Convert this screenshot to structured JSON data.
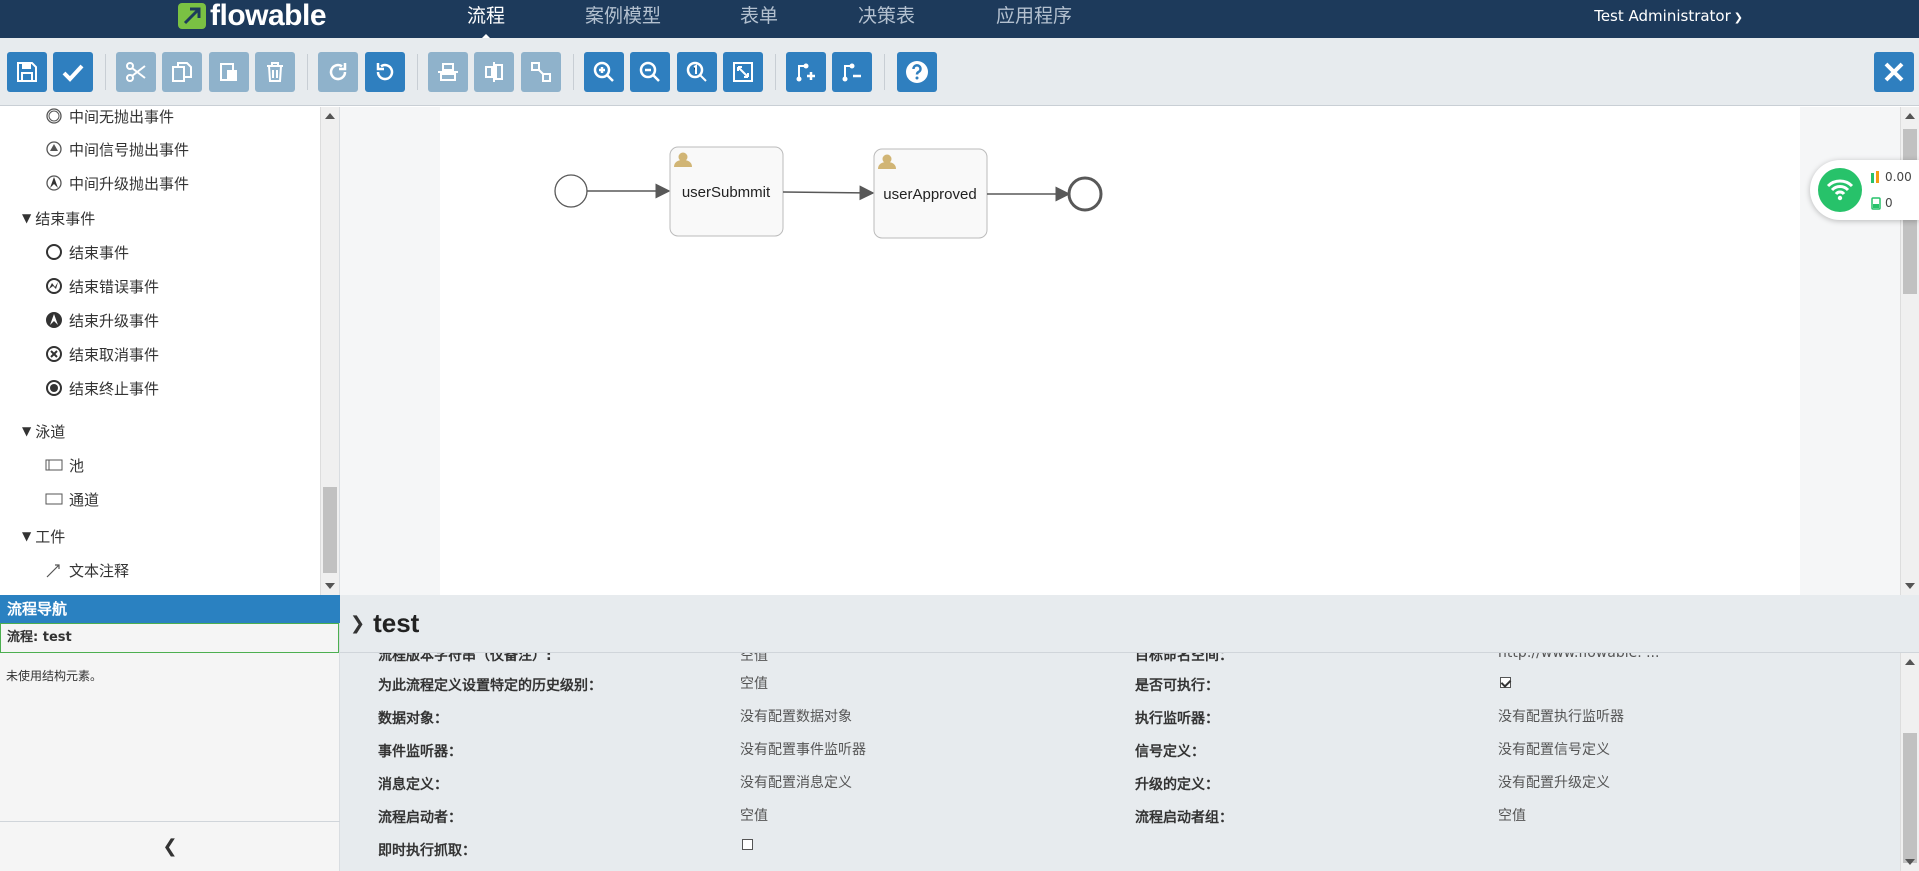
{
  "app": {
    "logo_text": "flowable"
  },
  "nav": {
    "tabs": [
      "流程",
      "案例模型",
      "表单",
      "决策表",
      "应用程序"
    ],
    "active_tab": "流程",
    "user": "Test Administrator"
  },
  "toolbar": {
    "buttons": [
      "save-icon",
      "validate-icon",
      "cut-icon",
      "copy-icon",
      "paste-icon",
      "delete-icon",
      "redo-icon",
      "undo-icon",
      "align-horizontal-icon",
      "align-vertical-icon",
      "same-size-icon",
      "zoom-in-icon",
      "zoom-out-icon",
      "zoom-actual-icon",
      "zoom-fit-icon",
      "add-bendpoint-icon",
      "remove-bendpoint-icon",
      "help-icon",
      "close-icon"
    ]
  },
  "palette": {
    "items_top": [
      "中间无抛出事件",
      "中间信号抛出事件",
      "中间升级抛出事件"
    ],
    "groups": [
      {
        "label": "结束事件",
        "items": [
          "结束事件",
          "结束错误事件",
          "结束升级事件",
          "结束取消事件",
          "结束终止事件"
        ]
      },
      {
        "label": "泳道",
        "items": [
          "池",
          "通道"
        ]
      },
      {
        "label": "工件",
        "items": [
          "文本注释"
        ]
      }
    ]
  },
  "diagram": {
    "tasks": [
      "userSubmmit",
      "userApproved"
    ]
  },
  "net_widget": {
    "speed": "0.00",
    "count": "0"
  },
  "navigator": {
    "title": "流程导航",
    "process": "流程: test",
    "note": "未使用结构元素。"
  },
  "properties": {
    "title": "test",
    "rows": [
      {
        "l_label": "流程版本字符串（仅备注）:",
        "l_value": "空值",
        "r_label": "目标命名空间：",
        "r_value": "http://www.flowable. ..."
      },
      {
        "l_label": "为此流程定义设置特定的历史级别：",
        "l_value": "空值",
        "r_label": "是否可执行：",
        "r_value": ""
      },
      {
        "l_label": "数据对象：",
        "l_value": "没有配置数据对象",
        "r_label": "执行监听器：",
        "r_value": "没有配置执行监听器"
      },
      {
        "l_label": "事件监听器：",
        "l_value": "没有配置事件监听器",
        "r_label": "信号定义：",
        "r_value": "没有配置信号定义"
      },
      {
        "l_label": "消息定义：",
        "l_value": "没有配置消息定义",
        "r_label": "升级的定义：",
        "r_value": "没有配置升级定义"
      },
      {
        "l_label": "流程启动者：",
        "l_value": "空值",
        "r_label": "流程启动者组：",
        "r_value": "空值"
      },
      {
        "l_label": "即时执行抓取：",
        "l_value": "",
        "r_label": "",
        "r_value": ""
      }
    ],
    "is_executable": true,
    "eager_execution_fetch": false
  }
}
